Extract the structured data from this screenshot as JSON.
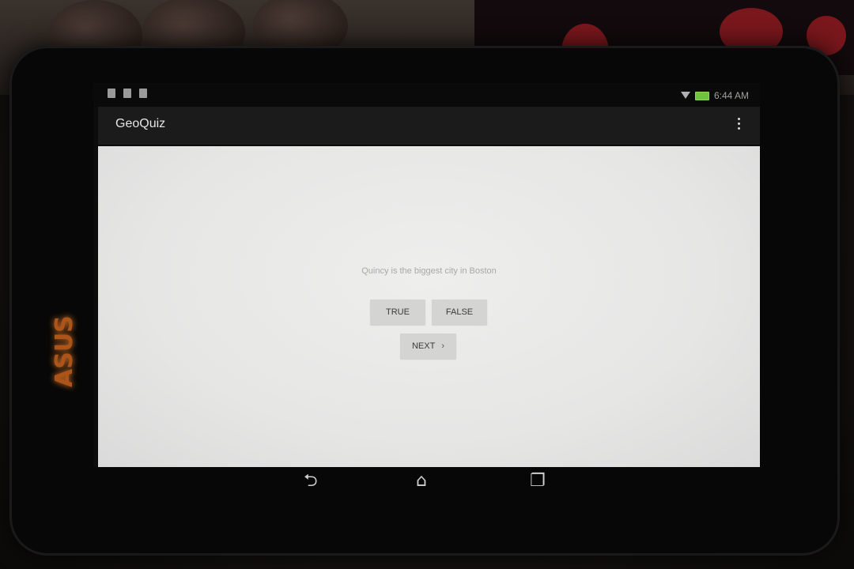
{
  "status_bar": {
    "time": "6:44 AM"
  },
  "app": {
    "title": "GeoQuiz"
  },
  "quiz": {
    "question": "Quincy is the biggest city in Boston",
    "true_label": "TRUE",
    "false_label": "FALSE",
    "next_label": "NEXT"
  },
  "icons": {
    "overflow": "overflow-menu-icon",
    "back": "back-icon",
    "home": "home-icon",
    "recent": "recent-apps-icon",
    "wifi": "wifi-icon",
    "battery": "battery-icon"
  },
  "colors": {
    "screen_bg": "#e9e9e8",
    "button_bg": "#d4d4d3",
    "action_bar": "#1b1b1b",
    "battery": "#6ec43a"
  }
}
